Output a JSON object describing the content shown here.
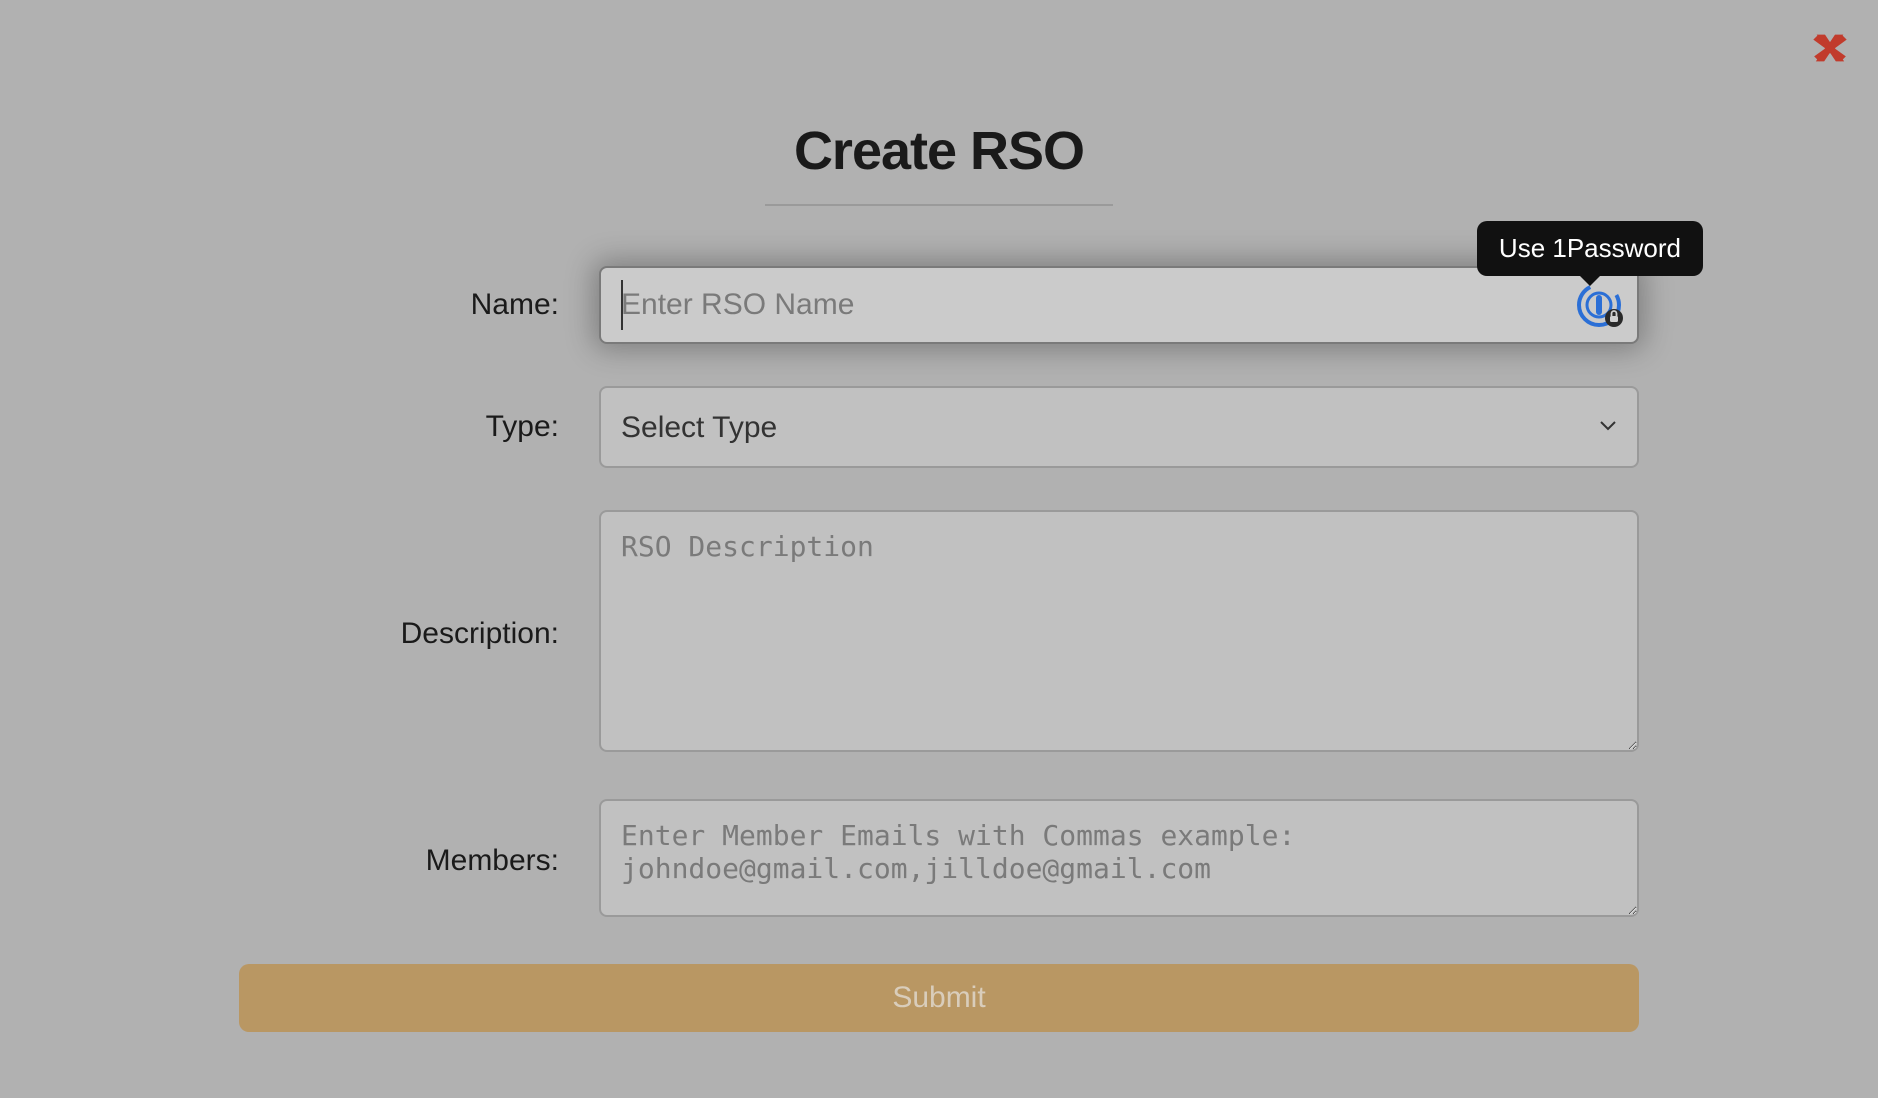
{
  "modal": {
    "title": "Create RSO"
  },
  "form": {
    "name": {
      "label": "Name:",
      "placeholder": "Enter RSO Name",
      "value": ""
    },
    "type": {
      "label": "Type:",
      "placeholder": "Select Type",
      "value": ""
    },
    "description": {
      "label": "Description:",
      "placeholder": "RSO Description",
      "value": ""
    },
    "members": {
      "label": "Members:",
      "placeholder": "Enter Member Emails with Commas example: johndoe@gmail.com,jilldoe@gmail.com",
      "value": ""
    },
    "submit_label": "Submit"
  },
  "onepassword": {
    "tooltip": "Use 1Password"
  }
}
